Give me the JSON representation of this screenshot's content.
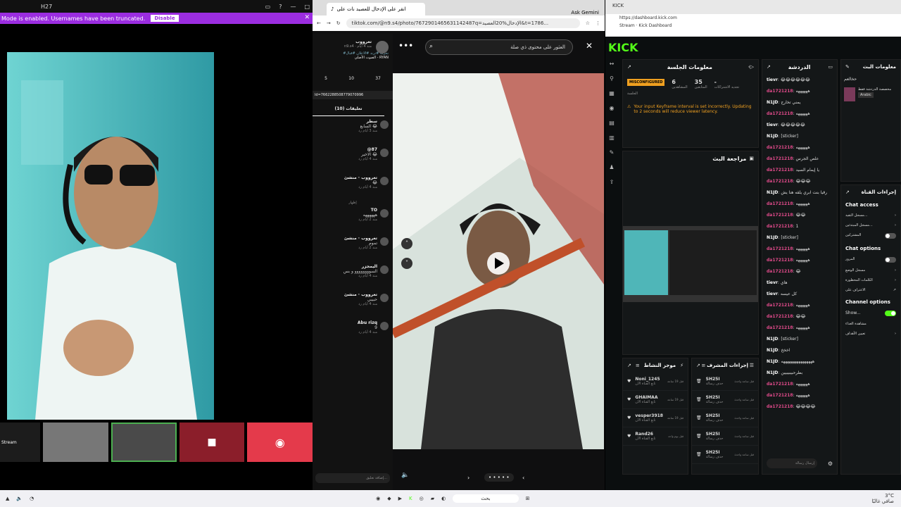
{
  "left_window": {
    "title": "H27",
    "banner": "Mode is enabled. Usernames have been truncated.",
    "disable_label": "Disable",
    "stream_label": "Stream"
  },
  "browser": {
    "tab_title": "انقر على الإدخال للعصيد نات على",
    "tab2": "Ask Gemini",
    "url": "tiktok.com/@n9.s4/photo/7672901465631142487q=الإدخال%20العصيد&t=1786..."
  },
  "tiktok": {
    "search_placeholder": "العثور على محتوى ذي صلة",
    "author": "تعرووب",
    "author_meta": "n9.s4 · منذ 4 أيام",
    "caption": "#تحرب #ترند #الاعلان #قبال",
    "music": "الصوت الأصلي - RYAN",
    "stats": {
      "likes": "37",
      "comments": "10",
      "saves": "5"
    },
    "link_id": "ld=7662288508779070996",
    "comments_tab": "تعليقات (10)",
    "comments": [
      {
        "name": "سطر",
        "text": "السابع 😂",
        "meta": "منذ 3 أيام رد"
      },
      {
        "name": "@87",
        "text": "الاخير 😂",
        "meta": "منذ 4 أيام رد"
      },
      {
        "name": "تعرووب · منشئ",
        "text": "😂",
        "meta": "منذ 4 أيام رد"
      },
      {
        "name": "TO",
        "text": "ههههههه",
        "meta": "منذ 2 أيام رد"
      },
      {
        "name": "تعرووب · منشئ",
        "text": "تموم",
        "meta": "منذ 2 أيام رد"
      },
      {
        "name": "اليمجزر",
        "text": "السوووووووو و بس",
        "meta": "منذ 4 أيام رد"
      },
      {
        "name": "تعرووب · منشئ",
        "text": "حبيبي",
        "meta": "منذ 4 أيام رد"
      },
      {
        "name": "Abu rizq",
        "text": "9",
        "meta": "منذ 4 أيام رد"
      }
    ],
    "view_replies": "إظهار",
    "add_comment": "إضافة تعليق...",
    "pager": "• • • • •"
  },
  "kick": {
    "url": "https://dashboard.kick.com",
    "page_title": "Stream · Kick Dashboard",
    "logo": "KICK",
    "session": {
      "title": "معلومات الجلسة",
      "status_badge": "MISCONFIGURED",
      "status_label": "الجلسة",
      "viewers": "6",
      "viewers_label": "المشاهدين",
      "followers": "35",
      "followers_label": "المتابعين",
      "subs": "-",
      "subs_label": "تجديد الاشتراكات",
      "warning": "Your input Keyframe interval is set incorrectly. Updating to 2 seconds will reduce viewer latency."
    },
    "preview_title": "مراجعة البث",
    "chat_title": "الدردشة",
    "chat": [
      {
        "u": "tievr",
        "m": "😂😂😂😂😂😂"
      },
      {
        "u": "da1721218",
        "m": "ههههههه"
      },
      {
        "u": "N1JD",
        "m": "يمني تخارج"
      },
      {
        "u": "da1721218",
        "m": "ههههههه"
      },
      {
        "u": "tievr",
        "m": "😂😂😂😂😂"
      },
      {
        "u": "N1JD",
        "m": "[sticker]"
      },
      {
        "u": "da1721218",
        "m": "ههههههه"
      },
      {
        "u": "da1721218",
        "m": "علص الجرس"
      },
      {
        "u": "da1721218",
        "m": "يا إيمام السيد"
      },
      {
        "u": "da1721218",
        "m": "😂😂😂"
      },
      {
        "u": "N1JD",
        "m": "رقيا بنت ابري يلقه هنا يش"
      },
      {
        "u": "da1721218",
        "m": "ههههههه"
      },
      {
        "u": "da1721218",
        "m": "😂😂"
      },
      {
        "u": "da1721218",
        "m": "1"
      },
      {
        "u": "N1JD",
        "m": "[sticker]"
      },
      {
        "u": "da1721218",
        "m": "ههههههه"
      },
      {
        "u": "da1721218",
        "m": "ههههههه"
      },
      {
        "u": "da1721218",
        "m": "😂"
      },
      {
        "u": "tievr",
        "m": "هاي"
      },
      {
        "u": "tievr",
        "m": "كل عيسه"
      },
      {
        "u": "da1721218",
        "m": "ههههههه"
      },
      {
        "u": "da1721218",
        "m": "😂😂"
      },
      {
        "u": "da1721218",
        "m": "ههههههه"
      },
      {
        "u": "N1JD",
        "m": "[sticker]"
      },
      {
        "u": "N1JD",
        "m": "اخخخ"
      },
      {
        "u": "N1JD",
        "m": "ههههههههههههههههه"
      },
      {
        "u": "N1JD",
        "m": "بطرحبيبيبيين"
      },
      {
        "u": "da1721218",
        "m": "ههههههه"
      },
      {
        "u": "da1721218",
        "m": "ههههههه"
      },
      {
        "u": "da1721218",
        "m": "😂😂😂😂"
      }
    ],
    "chat_placeholder": "إرسال رسالة",
    "activity_title": "موجز النشاط",
    "activity": [
      {
        "name": "Noni_1245",
        "desc": "تابع القناة الآن",
        "time": "قبل 19 ساعة"
      },
      {
        "name": "GHAIMAA",
        "desc": "تابع القناة الآن",
        "time": "قبل 19 ساعة"
      },
      {
        "name": "vesper3918",
        "desc": "تابع القناة الآن",
        "time": "قبل 19 ساعة"
      },
      {
        "name": "Rand26",
        "desc": "تابع القناة الآن",
        "time": "قبل يوم واحد"
      }
    ],
    "mod_title": "إجراءات المشرف",
    "mod": [
      {
        "name": "SH25I",
        "desc": "حذف رسالة",
        "time": "قبل ساعة واحدة"
      },
      {
        "name": "SH25I",
        "desc": "حذف رسالة",
        "time": "قبل ساعة واحدة"
      },
      {
        "name": "SH25I",
        "desc": "حذف رسالة",
        "time": "قبل ساعة واحدة"
      },
      {
        "name": "SH25I",
        "desc": "حذف رسالة",
        "time": "قبل ساعة واحدة"
      },
      {
        "name": "SH25I",
        "desc": "حذف رسالة",
        "time": "قبل ساعة واحدة"
      }
    ],
    "stream_info_title": "معلومات البث",
    "stream_info_category": "حخالعم",
    "stream_info_desc": "مخصصة الدردشة فقط",
    "stream_info_lang": "Arabic",
    "channel_actions_title": "إجراءات القناة",
    "chat_access": "Chat access",
    "chat_access_items": [
      "مسجل التقيد...",
      "مسجل المبتدئين..."
    ],
    "subscribers_only": "المشتركين",
    "chat_options": "Chat options",
    "chat_options_items": [
      "المرور",
      "مسجل الوضع",
      "الكلمات المحظورة",
      "الاعتراف على"
    ],
    "channel_options": "Channel options",
    "channel_show": "Show...",
    "channel_items": [
      "مشاهدة الغذاء",
      "تعيين الأهداف"
    ]
  },
  "taskbar": {
    "time": "3°C",
    "search": "بحث",
    "weather": "صافي غالبًا"
  }
}
